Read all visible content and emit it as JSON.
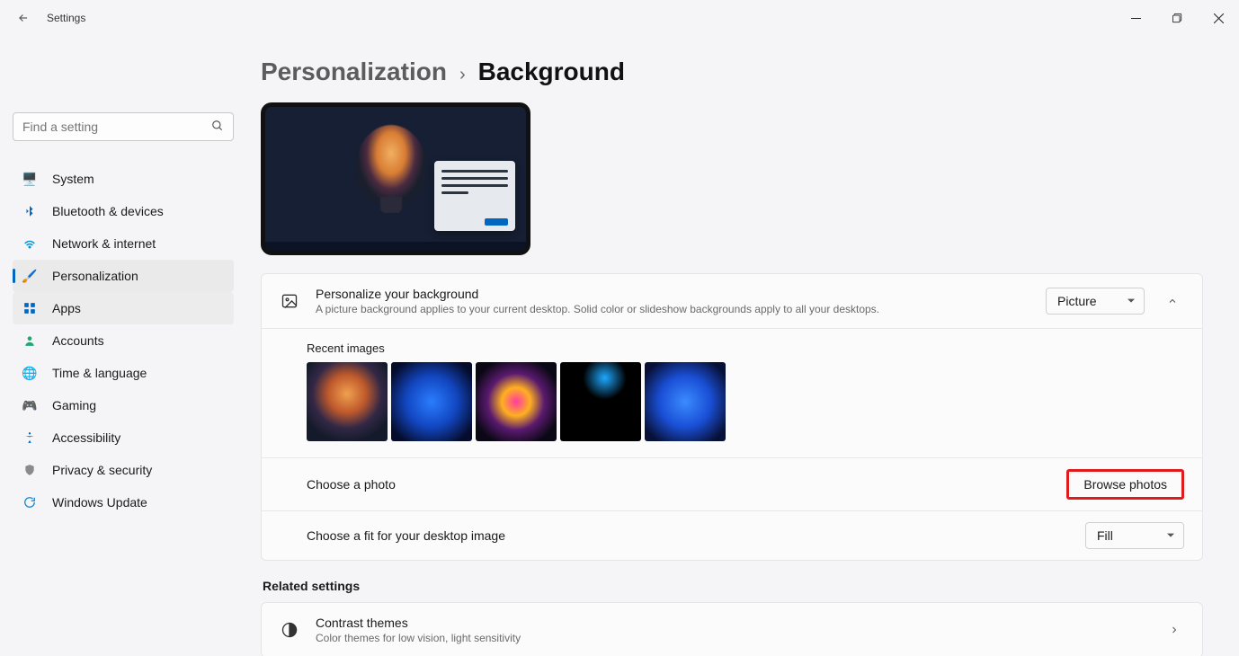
{
  "window": {
    "title": "Settings"
  },
  "search": {
    "placeholder": "Find a setting"
  },
  "sidebar": {
    "items": [
      {
        "label": "System"
      },
      {
        "label": "Bluetooth & devices"
      },
      {
        "label": "Network & internet"
      },
      {
        "label": "Personalization"
      },
      {
        "label": "Apps"
      },
      {
        "label": "Accounts"
      },
      {
        "label": "Time & language"
      },
      {
        "label": "Gaming"
      },
      {
        "label": "Accessibility"
      },
      {
        "label": "Privacy & security"
      },
      {
        "label": "Windows Update"
      }
    ]
  },
  "breadcrumb": {
    "parent": "Personalization",
    "current": "Background"
  },
  "personalize": {
    "title": "Personalize your background",
    "sub": "A picture background applies to your current desktop. Solid color or slideshow backgrounds apply to all your desktops.",
    "dropdown": "Picture"
  },
  "recent": {
    "label": "Recent images"
  },
  "choose_photo": {
    "label": "Choose a photo",
    "button": "Browse photos"
  },
  "choose_fit": {
    "label": "Choose a fit for your desktop image",
    "dropdown": "Fill"
  },
  "related": {
    "header": "Related settings",
    "contrast_title": "Contrast themes",
    "contrast_sub": "Color themes for low vision, light sensitivity"
  }
}
